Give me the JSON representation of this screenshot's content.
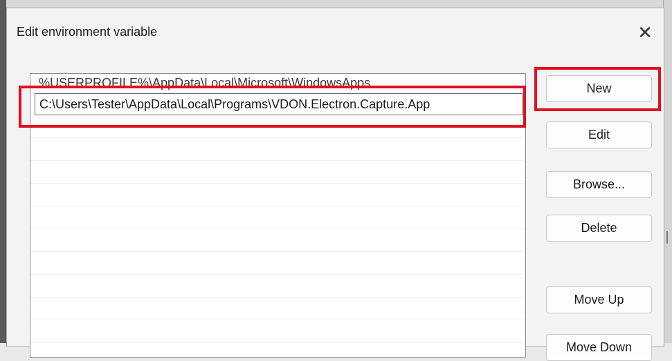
{
  "dialog": {
    "title": "Edit environment variable",
    "close_glyph": "✕"
  },
  "list": {
    "items": [
      "%USERPROFILE%\\AppData\\Local\\Microsoft\\WindowsApps",
      "C:\\Users\\Tester\\AppData\\Local\\Programs\\VDON.Electron.Capture.App"
    ],
    "editing_index": 1
  },
  "buttons": {
    "new": "New",
    "edit": "Edit",
    "browse": "Browse...",
    "delete": "Delete",
    "move_up": "Move Up",
    "move_down": "Move Down"
  },
  "annotations": {
    "highlight_color": "#e0101e"
  }
}
